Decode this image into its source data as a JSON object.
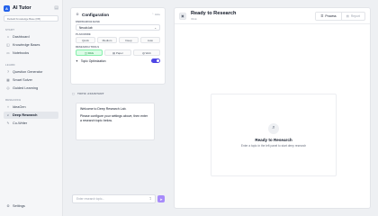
{
  "app": {
    "name": "AI Tutor",
    "logo_letter": "A"
  },
  "sidebar": {
    "kb_selector": "Default Knowledge Base (KB)",
    "sections": {
      "start": "START",
      "learn": "LEARN",
      "research": "RESEARCH"
    },
    "start_items": [
      {
        "label": "Dashboard",
        "icon": "home-icon"
      },
      {
        "label": "Knowledge Bases",
        "icon": "database-icon"
      },
      {
        "label": "Notebooks",
        "icon": "book-icon"
      }
    ],
    "learn_items": [
      {
        "label": "Question Generator",
        "icon": "question-icon"
      },
      {
        "label": "Smart Solver",
        "icon": "calculator-icon"
      },
      {
        "label": "Guided Learning",
        "icon": "compass-icon"
      }
    ],
    "research_items": [
      {
        "label": "IdeaGen",
        "icon": "lightbulb-icon"
      },
      {
        "label": "Deep Research",
        "icon": "microscope-icon",
        "active": true
      },
      {
        "label": "Co-Writer",
        "icon": "pen-icon"
      }
    ],
    "settings": "Settings"
  },
  "config": {
    "title": "Configuration",
    "head_action": "Hide",
    "kb_label": "KNOWLEDGE BASE",
    "kb_value": "Neuob-lab",
    "plan_label": "PLAN MODE",
    "plan_options": [
      "Quick",
      "Medium",
      "Deep",
      "Auto"
    ],
    "tools_label": "RESEARCH TOOLS",
    "tools": [
      {
        "label": "RAG",
        "on": true
      },
      {
        "label": "Paper",
        "on": false
      },
      {
        "label": "Web",
        "on": false
      }
    ],
    "toggle_label": "Topic Optimization",
    "toggle_on": true
  },
  "assistant": {
    "label": "TOPIC ASSISTANT",
    "welcome": "Welcome to Deep Research Lab.",
    "message": "Please configure your settings above, then enter a research topic below.",
    "input_placeholder": "Enter research topic..."
  },
  "main": {
    "title": "Ready to Research",
    "subtitle": "IDLE",
    "tabs": [
      {
        "label": "Process",
        "on": true
      },
      {
        "label": "Report",
        "on": false
      }
    ],
    "empty_title": "Ready to Research",
    "empty_sub": "Enter a topic in the left panel to start deep research"
  },
  "colors": {
    "accent": "#4f46e5",
    "send": "#a78bfa",
    "rag_on": "#dcfce7"
  }
}
